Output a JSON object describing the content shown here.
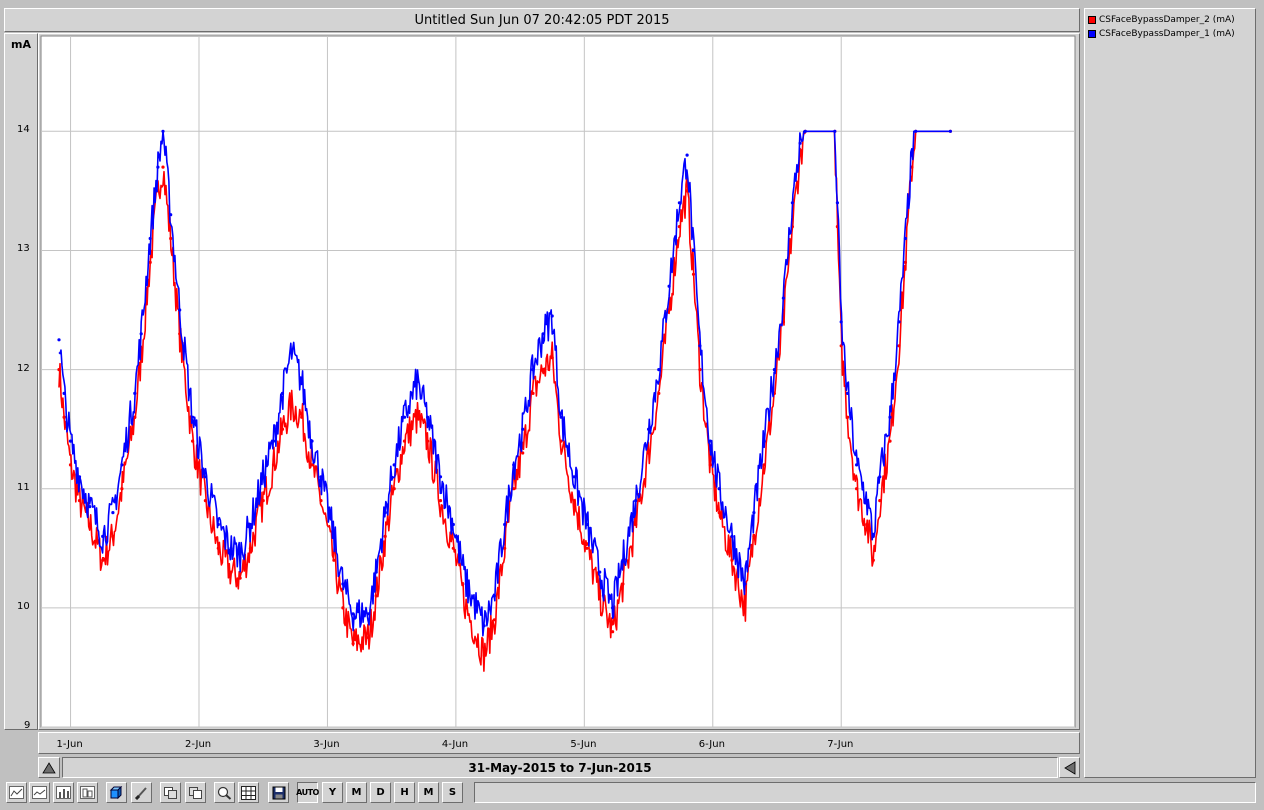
{
  "window": {
    "title": "Untitled Sun Jun 07 20:42:05 PDT 2015",
    "unit": "mA",
    "range_label": "31-May-2015 to 7-Jun-2015"
  },
  "legend": [
    {
      "label": "CSFaceBypassDamper_2 (mA)",
      "color": "#ff0000"
    },
    {
      "label": "CSFaceBypassDamper_1 (mA)",
      "color": "#0000ff"
    }
  ],
  "toolbar": {
    "buttons": [
      {
        "name": "line-plot-icon",
        "label": ""
      },
      {
        "name": "area-plot-icon",
        "label": ""
      },
      {
        "name": "bar-plot-icon",
        "label": ""
      },
      {
        "name": "step-plot-icon",
        "label": ""
      },
      {
        "name": "cube-icon",
        "label": ""
      },
      {
        "name": "brush-icon",
        "label": ""
      },
      {
        "name": "copy-icon",
        "label": ""
      },
      {
        "name": "paste-icon",
        "label": ""
      },
      {
        "name": "zoom-icon",
        "label": ""
      },
      {
        "name": "grid-icon",
        "label": ""
      },
      {
        "name": "save-icon",
        "label": ""
      },
      {
        "name": "auto-scale-button",
        "label": "AUTO"
      },
      {
        "name": "year-button",
        "label": "Y"
      },
      {
        "name": "month-button",
        "label": "M"
      },
      {
        "name": "day-button",
        "label": "D"
      },
      {
        "name": "hour-button",
        "label": "H"
      },
      {
        "name": "minute-button",
        "label": "M"
      },
      {
        "name": "second-button",
        "label": "S"
      }
    ]
  },
  "chart_data": {
    "type": "line",
    "title": "Untitled Sun Jun 07 20:42:05 PDT 2015",
    "xlabel": "31-May-2015 to 7-Jun-2015",
    "ylabel": "mA",
    "xlim": [
      -0.23,
      7.82
    ],
    "ylim": [
      9,
      14.8
    ],
    "yticks": [
      9,
      10,
      11,
      12,
      13,
      14
    ],
    "xticks": [
      {
        "v": 0,
        "label": "1-Jun"
      },
      {
        "v": 1,
        "label": "2-Jun"
      },
      {
        "v": 2,
        "label": "3-Jun"
      },
      {
        "v": 3,
        "label": "4-Jun"
      },
      {
        "v": 4,
        "label": "5-Jun"
      },
      {
        "v": 5,
        "label": "6-Jun"
      },
      {
        "v": 6,
        "label": "7-Jun"
      }
    ],
    "grid": true,
    "legend_position": "right",
    "series": [
      {
        "name": "CSFaceBypassDamper_2 (mA)",
        "color": "#ff0000",
        "points": [
          [
            -0.09,
            12.0
          ],
          [
            -0.05,
            11.6
          ],
          [
            0.0,
            11.2
          ],
          [
            0.07,
            10.9
          ],
          [
            0.15,
            10.7
          ],
          [
            0.25,
            10.4
          ],
          [
            0.33,
            10.6
          ],
          [
            0.4,
            11.0
          ],
          [
            0.5,
            11.6
          ],
          [
            0.55,
            12.1
          ],
          [
            0.62,
            12.9
          ],
          [
            0.68,
            13.5
          ],
          [
            0.72,
            13.7
          ],
          [
            0.78,
            13.1
          ],
          [
            0.85,
            12.3
          ],
          [
            0.95,
            11.4
          ],
          [
            1.05,
            10.9
          ],
          [
            1.15,
            10.5
          ],
          [
            1.25,
            10.3
          ],
          [
            1.32,
            10.25
          ],
          [
            1.4,
            10.5
          ],
          [
            1.5,
            10.9
          ],
          [
            1.58,
            11.2
          ],
          [
            1.65,
            11.5
          ],
          [
            1.72,
            11.7
          ],
          [
            1.8,
            11.6
          ],
          [
            1.88,
            11.2
          ],
          [
            1.95,
            10.9
          ],
          [
            2.05,
            10.4
          ],
          [
            2.12,
            10.0
          ],
          [
            2.2,
            9.7
          ],
          [
            2.32,
            9.75
          ],
          [
            2.38,
            10.1
          ],
          [
            2.45,
            10.6
          ],
          [
            2.52,
            11.0
          ],
          [
            2.6,
            11.4
          ],
          [
            2.7,
            11.6
          ],
          [
            2.78,
            11.4
          ],
          [
            2.88,
            10.9
          ],
          [
            2.98,
            10.5
          ],
          [
            3.08,
            10.0
          ],
          [
            3.22,
            9.6
          ],
          [
            3.3,
            9.9
          ],
          [
            3.38,
            10.5
          ],
          [
            3.45,
            11.0
          ],
          [
            3.52,
            11.3
          ],
          [
            3.6,
            11.8
          ],
          [
            3.68,
            12.0
          ],
          [
            3.75,
            12.1
          ],
          [
            3.82,
            11.4
          ],
          [
            3.92,
            10.9
          ],
          [
            4.02,
            10.5
          ],
          [
            4.12,
            10.1
          ],
          [
            4.22,
            9.8
          ],
          [
            4.3,
            10.2
          ],
          [
            4.4,
            10.7
          ],
          [
            4.5,
            11.3
          ],
          [
            4.58,
            11.8
          ],
          [
            4.66,
            12.5
          ],
          [
            4.74,
            13.2
          ],
          [
            4.8,
            13.5
          ],
          [
            4.85,
            12.8
          ],
          [
            4.9,
            12.0
          ],
          [
            4.98,
            11.2
          ],
          [
            5.05,
            10.8
          ],
          [
            5.15,
            10.4
          ],
          [
            5.25,
            10.0
          ],
          [
            5.32,
            10.6
          ],
          [
            5.4,
            11.2
          ],
          [
            5.48,
            11.8
          ],
          [
            5.55,
            12.4
          ],
          [
            5.62,
            13.2
          ],
          [
            5.68,
            13.8
          ],
          [
            5.72,
            14.0
          ],
          [
            5.95,
            14.0
          ],
          [
            5.97,
            13.2
          ],
          [
            6.0,
            12.2
          ],
          [
            6.05,
            11.6
          ],
          [
            6.12,
            11.0
          ],
          [
            6.2,
            10.7
          ],
          [
            6.25,
            10.4
          ],
          [
            6.3,
            10.9
          ],
          [
            6.38,
            11.4
          ],
          [
            6.45,
            12.2
          ],
          [
            6.5,
            12.9
          ],
          [
            6.55,
            13.7
          ],
          [
            6.58,
            14.0
          ],
          [
            6.85,
            14.0
          ]
        ]
      },
      {
        "name": "CSFaceBypassDamper_1 (mA)",
        "color": "#0000ff",
        "points": [
          [
            -0.09,
            12.25
          ],
          [
            -0.05,
            11.8
          ],
          [
            0.0,
            11.4
          ],
          [
            0.07,
            11.1
          ],
          [
            0.15,
            10.85
          ],
          [
            0.25,
            10.6
          ],
          [
            0.33,
            10.8
          ],
          [
            0.4,
            11.2
          ],
          [
            0.5,
            11.8
          ],
          [
            0.55,
            12.3
          ],
          [
            0.62,
            13.1
          ],
          [
            0.68,
            13.7
          ],
          [
            0.72,
            14.0
          ],
          [
            0.78,
            13.3
          ],
          [
            0.85,
            12.5
          ],
          [
            0.95,
            11.6
          ],
          [
            1.05,
            11.1
          ],
          [
            1.15,
            10.7
          ],
          [
            1.25,
            10.5
          ],
          [
            1.32,
            10.45
          ],
          [
            1.4,
            10.7
          ],
          [
            1.5,
            11.1
          ],
          [
            1.58,
            11.4
          ],
          [
            1.65,
            11.8
          ],
          [
            1.72,
            12.15
          ],
          [
            1.8,
            11.9
          ],
          [
            1.88,
            11.4
          ],
          [
            1.95,
            11.1
          ],
          [
            2.05,
            10.6
          ],
          [
            2.12,
            10.2
          ],
          [
            2.2,
            9.95
          ],
          [
            2.32,
            9.95
          ],
          [
            2.38,
            10.3
          ],
          [
            2.45,
            10.8
          ],
          [
            2.52,
            11.2
          ],
          [
            2.6,
            11.6
          ],
          [
            2.7,
            11.9
          ],
          [
            2.78,
            11.6
          ],
          [
            2.88,
            11.1
          ],
          [
            2.98,
            10.7
          ],
          [
            3.08,
            10.2
          ],
          [
            3.22,
            9.85
          ],
          [
            3.3,
            10.1
          ],
          [
            3.38,
            10.7
          ],
          [
            3.45,
            11.2
          ],
          [
            3.52,
            11.5
          ],
          [
            3.6,
            12.0
          ],
          [
            3.68,
            12.3
          ],
          [
            3.75,
            12.45
          ],
          [
            3.82,
            11.6
          ],
          [
            3.92,
            11.1
          ],
          [
            4.02,
            10.7
          ],
          [
            4.12,
            10.3
          ],
          [
            4.22,
            10.0
          ],
          [
            4.3,
            10.4
          ],
          [
            4.4,
            10.9
          ],
          [
            4.5,
            11.5
          ],
          [
            4.58,
            12.0
          ],
          [
            4.66,
            12.7
          ],
          [
            4.74,
            13.4
          ],
          [
            4.8,
            13.8
          ],
          [
            4.85,
            13.0
          ],
          [
            4.9,
            12.2
          ],
          [
            4.98,
            11.4
          ],
          [
            5.05,
            11.0
          ],
          [
            5.15,
            10.6
          ],
          [
            5.25,
            10.2
          ],
          [
            5.32,
            10.8
          ],
          [
            5.4,
            11.4
          ],
          [
            5.48,
            12.0
          ],
          [
            5.55,
            12.6
          ],
          [
            5.62,
            13.4
          ],
          [
            5.68,
            13.9
          ],
          [
            5.72,
            14.0
          ],
          [
            5.95,
            14.0
          ],
          [
            5.97,
            13.4
          ],
          [
            6.0,
            12.4
          ],
          [
            6.05,
            11.8
          ],
          [
            6.12,
            11.2
          ],
          [
            6.2,
            10.9
          ],
          [
            6.25,
            10.6
          ],
          [
            6.3,
            11.1
          ],
          [
            6.38,
            11.6
          ],
          [
            6.45,
            12.4
          ],
          [
            6.5,
            13.1
          ],
          [
            6.55,
            13.8
          ],
          [
            6.58,
            14.0
          ],
          [
            6.85,
            14.0
          ]
        ]
      }
    ]
  }
}
